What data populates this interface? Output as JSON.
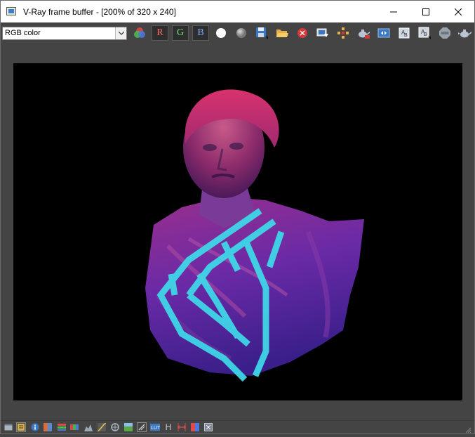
{
  "window": {
    "title": "V-Ray frame buffer - [200% of 320 x 240]"
  },
  "toolbar": {
    "channel_select_value": "RGB color",
    "channel_r_label": "R",
    "channel_g_label": "G",
    "channel_b_label": "B"
  },
  "statusbar": {
    "h_label": "H"
  },
  "colors": {
    "background": "#444444",
    "render_bg": "#000000",
    "bust_magenta": "#b0306e",
    "bust_violet": "#5a2fb0",
    "stripe_cyan": "#3fd6e8",
    "stop_red": "#d23a3a"
  }
}
